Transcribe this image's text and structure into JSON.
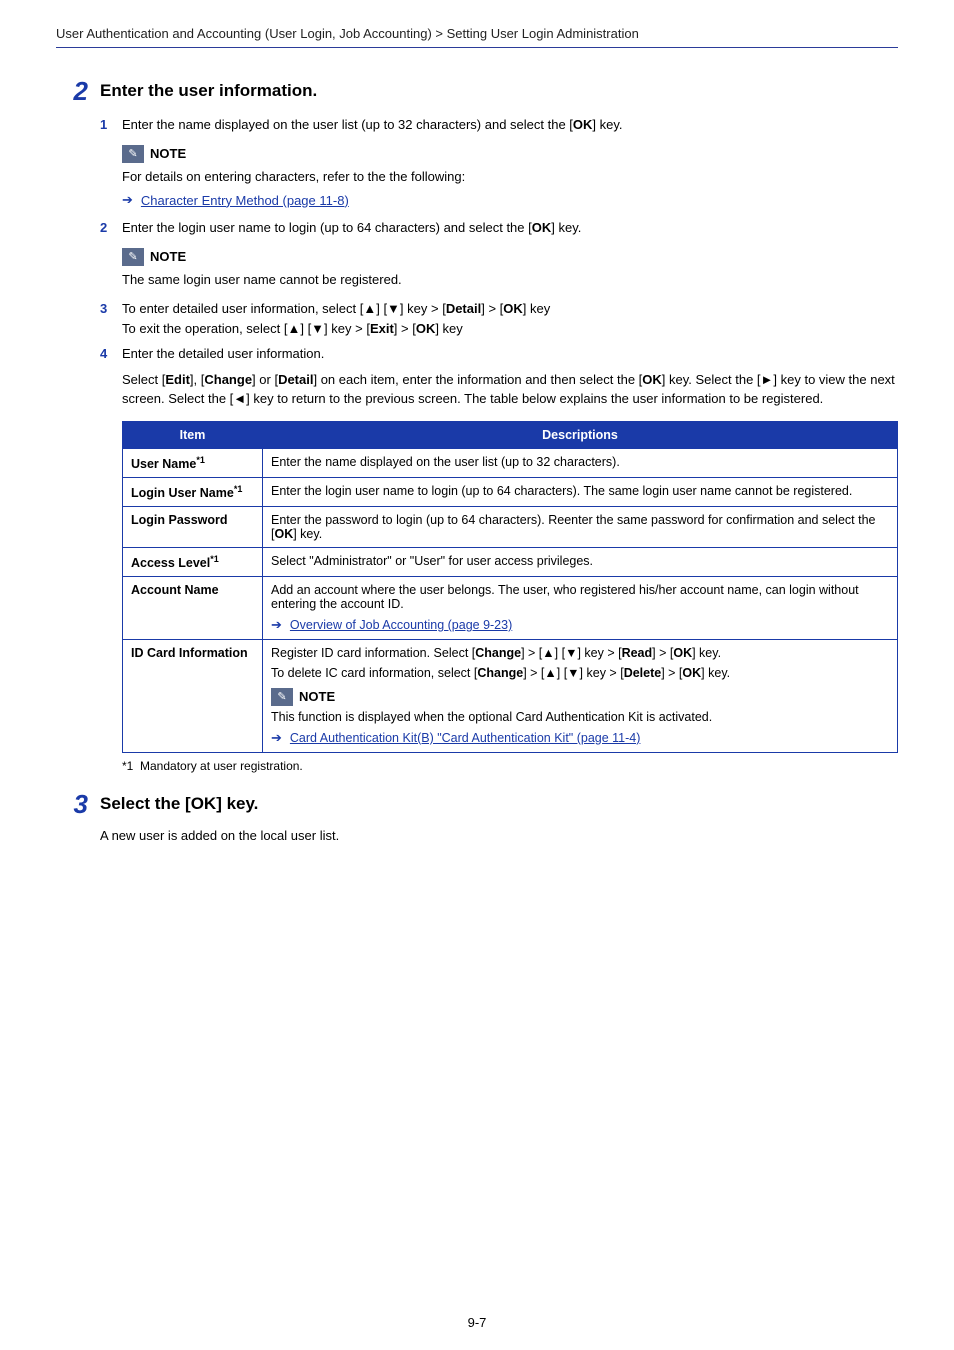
{
  "breadcrumb": "User Authentication and Accounting (User Login, Job Accounting) > Setting User Login Administration",
  "section2": {
    "num": "2",
    "heading": "Enter the user information.",
    "sub1": {
      "num": "1",
      "t1": "Enter the name displayed on the user list (up to 32 characters) and select the [",
      "t2": "] key."
    },
    "note1": {
      "label": "NOTE",
      "body": "For details on entering characters, refer to the the following:",
      "link": "Character Entry Method (page 11-8)"
    },
    "sub2": {
      "num": "2",
      "t1": "Enter the login user name to login (up to 64 characters) and select the [",
      "t2": "] key."
    },
    "note2": {
      "label": "NOTE",
      "body": "The same login user name cannot be registered."
    },
    "sub3": {
      "num": "3",
      "l1_a": "To enter detailed user information, select [▲] [▼] key > [",
      "l1_b": "] > [",
      "l1_c": "] key",
      "l2_a": "To exit the operation, select [▲] [▼] key > [",
      "l2_b": "] > [",
      "l2_c": "] key"
    },
    "sub4": {
      "num": "4",
      "text": "Enter the detailed user information."
    },
    "para": {
      "p1": "Select [",
      "p2": "], [",
      "p3": "] or [",
      "p4": "] on each item, enter the information and then select the [",
      "p5": "] key. Select the [►] key to view the next screen. Select the [◄] key to return to the previous screen. The table below explains the user information to be registered."
    }
  },
  "keys": {
    "ok": "OK",
    "detail": "Detail",
    "exit": "Exit",
    "edit": "Edit",
    "change": "Change",
    "read": "Read",
    "delete": "Delete"
  },
  "table": {
    "h_item": "Item",
    "h_desc": "Descriptions",
    "r1_item": "User Name",
    "r1_sup": "*1",
    "r1_desc": "Enter the name displayed on the user list (up to 32 characters).",
    "r2_item": "Login User Name",
    "r2_sup": "*1",
    "r2_desc": "Enter the login user name to login (up to 64 characters). The same login user name cannot be registered.",
    "r3_item": "Login Password",
    "r3_desc_a": "Enter the password to login (up to 64 characters). Reenter the same password for confirmation and select the [",
    "r3_desc_b": "] key.",
    "r4_item": "Access Level",
    "r4_sup": "*1",
    "r4_desc": "Select \"Administrator\" or \"User\" for user access privileges.",
    "r5_item": "Account Name",
    "r5_desc": "Add an account where the user belongs. The user, who registered his/her account name, can login without entering the account ID.",
    "r5_link": "Overview of Job Accounting (page 9-23)",
    "r6_item": "ID Card Information",
    "r6_p1_a": "Register ID card information. Select [",
    "r6_p1_b": "] > [▲] [▼] key > [",
    "r6_p1_c": "] > [",
    "r6_p1_d": "] key.",
    "r6_p2_a": "To delete IC card information, select [",
    "r6_p2_b": "] > [▲] [▼] key > [",
    "r6_p2_c": "] > [",
    "r6_p2_d": "] key.",
    "r6_note_label": "NOTE",
    "r6_note_body": "This function is displayed when the optional Card Authentication Kit is activated.",
    "r6_link": "Card Authentication Kit(B) \"Card Authentication Kit\" (page 11-4)"
  },
  "footnote": "Mandatory at user registration.",
  "footnote_ref": "*1",
  "section3": {
    "num": "3",
    "heading": "Select the [OK] key.",
    "body": "A new user is added on the local user list."
  },
  "pagenum": "9-7"
}
